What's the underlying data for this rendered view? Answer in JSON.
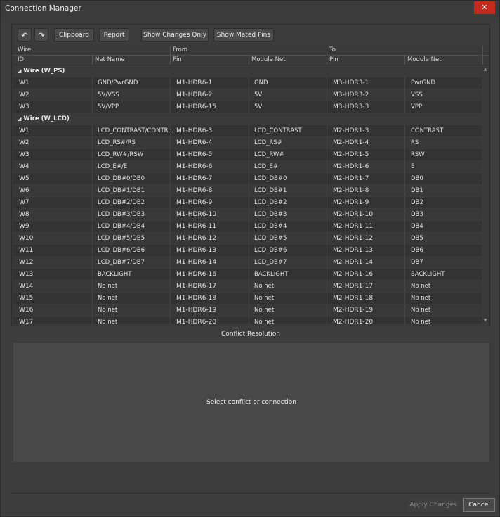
{
  "window": {
    "title": "Connection Manager",
    "close_glyph": "✕"
  },
  "toolbar": {
    "undo_glyph": "↶",
    "redo_glyph": "↷",
    "clipboard_label": "Clipboard",
    "report_label": "Report",
    "show_changes_label": "Show Changes Only",
    "show_mated_label": "Show Mated Pins"
  },
  "header": {
    "group_wire": "Wire",
    "group_from": "From",
    "group_to": "To",
    "col_id": "ID",
    "col_net_name": "Net Name",
    "col_from_pin": "Pin",
    "col_from_module_net": "Module Net",
    "col_to_pin": "Pin",
    "col_to_module_net": "Module Net"
  },
  "groups": [
    {
      "label": "Wire (W_PS)",
      "rows": [
        [
          "W1",
          "GND/PwrGND",
          "M1-HDR6-1",
          "GND",
          "M3-HDR3-1",
          "PwrGND"
        ],
        [
          "W2",
          "5V/VSS",
          "M1-HDR6-2",
          "5V",
          "M3-HDR3-2",
          "VSS"
        ],
        [
          "W3",
          "5V/VPP",
          "M1-HDR6-15",
          "5V",
          "M3-HDR3-3",
          "VPP"
        ]
      ]
    },
    {
      "label": "Wire (W_LCD)",
      "rows": [
        [
          "W1",
          "LCD_CONTRAST/CONTR...",
          "M1-HDR6-3",
          "LCD_CONTRAST",
          "M2-HDR1-3",
          "CONTRAST"
        ],
        [
          "W2",
          "LCD_RS#/RS",
          "M1-HDR6-4",
          "LCD_RS#",
          "M2-HDR1-4",
          "RS"
        ],
        [
          "W3",
          "LCD_RW#/RSW",
          "M1-HDR6-5",
          "LCD_RW#",
          "M2-HDR1-5",
          "RSW"
        ],
        [
          "W4",
          "LCD_E#/E",
          "M1-HDR6-6",
          "LCD_E#",
          "M2-HDR1-6",
          "E"
        ],
        [
          "W5",
          "LCD_DB#0/DB0",
          "M1-HDR6-7",
          "LCD_DB#0",
          "M2-HDR1-7",
          "DB0"
        ],
        [
          "W6",
          "LCD_DB#1/DB1",
          "M1-HDR6-8",
          "LCD_DB#1",
          "M2-HDR1-8",
          "DB1"
        ],
        [
          "W7",
          "LCD_DB#2/DB2",
          "M1-HDR6-9",
          "LCD_DB#2",
          "M2-HDR1-9",
          "DB2"
        ],
        [
          "W8",
          "LCD_DB#3/DB3",
          "M1-HDR6-10",
          "LCD_DB#3",
          "M2-HDR1-10",
          "DB3"
        ],
        [
          "W9",
          "LCD_DB#4/DB4",
          "M1-HDR6-11",
          "LCD_DB#4",
          "M2-HDR1-11",
          "DB4"
        ],
        [
          "W10",
          "LCD_DB#5/DB5",
          "M1-HDR6-12",
          "LCD_DB#5",
          "M2-HDR1-12",
          "DB5"
        ],
        [
          "W11",
          "LCD_DB#6/DB6",
          "M1-HDR6-13",
          "LCD_DB#6",
          "M2-HDR1-13",
          "DB6"
        ],
        [
          "W12",
          "LCD_DB#7/DB7",
          "M1-HDR6-14",
          "LCD_DB#7",
          "M2-HDR1-14",
          "DB7"
        ],
        [
          "W13",
          "BACKLIGHT",
          "M1-HDR6-16",
          "BACKLIGHT",
          "M2-HDR1-16",
          "BACKLIGHT"
        ],
        [
          "W14",
          "No net",
          "M1-HDR6-17",
          "No net",
          "M2-HDR1-17",
          "No net"
        ],
        [
          "W15",
          "No net",
          "M1-HDR6-18",
          "No net",
          "M2-HDR1-18",
          "No net"
        ],
        [
          "W16",
          "No net",
          "M1-HDR6-19",
          "No net",
          "M2-HDR1-19",
          "No net"
        ],
        [
          "W17",
          "No net",
          "M1-HDR6-20",
          "No net",
          "M2-HDR1-20",
          "No net"
        ]
      ]
    }
  ],
  "conflict": {
    "title": "Conflict Resolution",
    "message": "Select conflict or connection"
  },
  "footer": {
    "apply_label": "Apply Changes",
    "cancel_label": "Cancel"
  },
  "colors": {
    "window_bg": "#3d3d3d",
    "close_red": "#c42b1c"
  }
}
